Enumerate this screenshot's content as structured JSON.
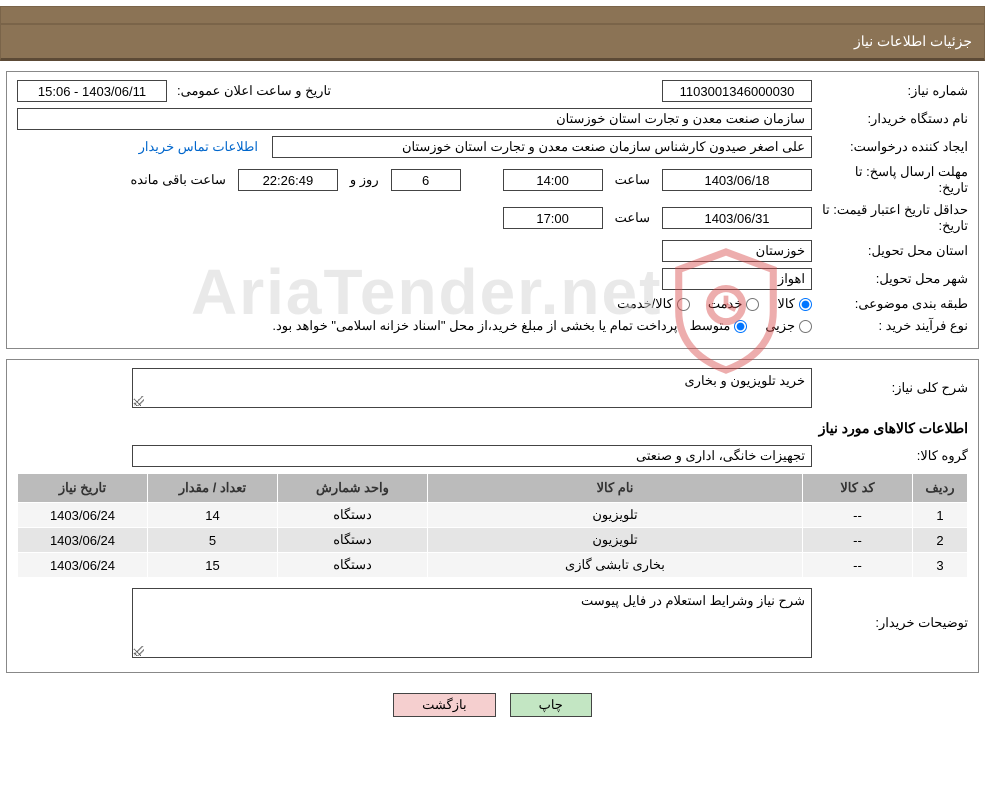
{
  "header": {
    "title": "جزئیات اطلاعات نیاز"
  },
  "fields": {
    "need_no_label": "شماره نیاز:",
    "need_no": "1103001346000030",
    "announce_label": "تاریخ و ساعت اعلان عمومی:",
    "announce_value": "1403/06/11 - 15:06",
    "buyer_org_label": "نام دستگاه خریدار:",
    "buyer_org": "سازمان صنعت معدن و تجارت استان خوزستان",
    "requester_label": "ایجاد کننده درخواست:",
    "requester": "علی اصغر صیدون کارشناس سازمان صنعت معدن و تجارت استان خوزستان",
    "contact_link": "اطلاعات تماس خریدار",
    "deadline_label": "مهلت ارسال پاسخ:",
    "until_date_label": "تا تاریخ:",
    "deadline_date": "1403/06/18",
    "hour_label": "ساعت",
    "deadline_hour": "14:00",
    "day_word": "روز و",
    "days_left": "6",
    "countdown": "22:26:49",
    "remain_label": "ساعت باقی مانده",
    "min_price_label": "حداقل تاریخ اعتبار قیمت:",
    "min_price_date": "1403/06/31",
    "min_price_hour": "17:00",
    "province_label": "استان محل تحویل:",
    "province": "خوزستان",
    "city_label": "شهر محل تحویل:",
    "city": "اهواز",
    "class_label": "طبقه بندی موضوعی:",
    "class_goods": "کالا",
    "class_service": "خدمت",
    "class_goods_service": "کالا/خدمت",
    "buy_type_label": "نوع فرآیند خرید :",
    "buy_type_partial": "جزیی",
    "buy_type_medium": "متوسط",
    "buy_type_note": "پرداخت تمام یا بخشی از مبلغ خرید،از محل \"اسناد خزانه اسلامی\" خواهد بود."
  },
  "need_desc": {
    "label": "شرح کلی نیاز:",
    "value": "خرید تلویزیون و بخاری"
  },
  "items_section_title": "اطلاعات کالاهای مورد نیاز",
  "group": {
    "label": "گروه کالا:",
    "value": "تجهیزات خانگی، اداری و صنعتی"
  },
  "table": {
    "headers": {
      "idx": "ردیف",
      "code": "کد کالا",
      "name": "نام کالا",
      "unit": "واحد شمارش",
      "qty": "تعداد / مقدار",
      "date": "تاریخ نیاز"
    },
    "rows": [
      {
        "idx": "1",
        "code": "--",
        "name": "تلویزیون",
        "unit": "دستگاه",
        "qty": "14",
        "date": "1403/06/24"
      },
      {
        "idx": "2",
        "code": "--",
        "name": "تلویزیون",
        "unit": "دستگاه",
        "qty": "5",
        "date": "1403/06/24"
      },
      {
        "idx": "3",
        "code": "--",
        "name": "بخاری تابشی گازی",
        "unit": "دستگاه",
        "qty": "15",
        "date": "1403/06/24"
      }
    ]
  },
  "buyer_note": {
    "label": "توضیحات خریدار:",
    "value": "شرح نیاز وشرایط استعلام در فایل پیوست"
  },
  "buttons": {
    "print": "چاپ",
    "back": "بازگشت"
  },
  "watermark": "AriaTender.net"
}
